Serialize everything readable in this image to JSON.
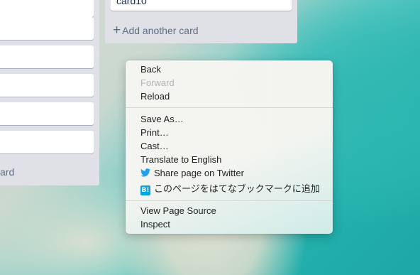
{
  "board": {
    "left_list": {
      "add_card_label": "ard"
    },
    "right_list": {
      "last_card_title": "card10",
      "add_card_label": "Add another card"
    }
  },
  "context_menu": {
    "items": [
      {
        "label": "Back",
        "enabled": true
      },
      {
        "label": "Forward",
        "enabled": false
      },
      {
        "label": "Reload",
        "enabled": true
      },
      {
        "label": "Save As…",
        "enabled": true
      },
      {
        "label": "Print…",
        "enabled": true
      },
      {
        "label": "Cast…",
        "enabled": true
      },
      {
        "label": "Translate to English",
        "enabled": true
      },
      {
        "label": "Share page on Twitter",
        "enabled": true,
        "icon": "twitter-icon"
      },
      {
        "label": "このページをはてなブックマークに追加",
        "enabled": true,
        "icon": "hatena-bookmark-icon",
        "icon_text": "B!"
      },
      {
        "label": "View Page Source",
        "enabled": true
      },
      {
        "label": "Inspect",
        "enabled": true
      }
    ]
  },
  "colors": {
    "list_bg": "#dfe1e6",
    "twitter_blue": "#1da1f2",
    "hatena_blue": "#00a4de"
  }
}
